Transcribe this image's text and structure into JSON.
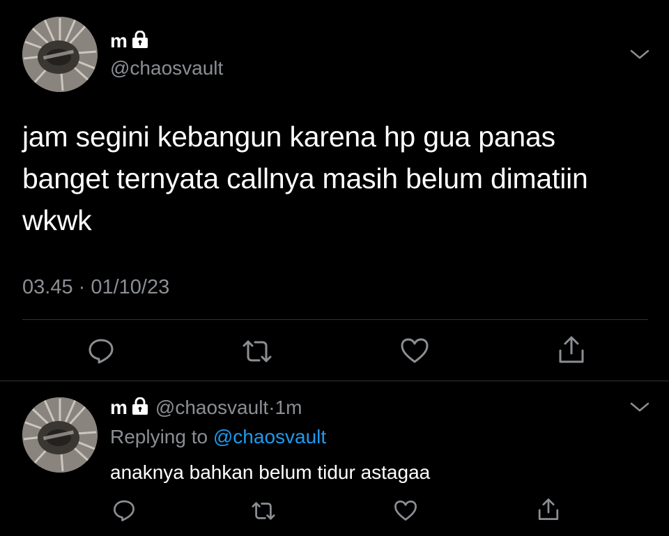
{
  "tweet": {
    "author_name": "m",
    "author_handle": "@chaosvault",
    "text_line1": "jam segini kebangun karena hp gua panas",
    "text_line2": "banget ternyata callnya masih belum dimatiin",
    "text_line3": "wkwk",
    "timestamp": "03.45 · 01/10/23",
    "icons": [
      "lock-icon",
      "chevron-down-icon",
      "reply-icon",
      "retweet-icon",
      "like-icon",
      "share-icon"
    ]
  },
  "reply": {
    "author_name": "m",
    "author_handle": "@chaosvault",
    "separator": "·",
    "time": "1m",
    "replying_prefix": "Replying to",
    "replying_mention": "@chaosvault",
    "text": "anaknya bahkan belum tidur astagaa"
  },
  "colors": {
    "background": "#000000",
    "primary_text": "#ffffff",
    "secondary_text": "#8b8f94",
    "link": "#1d9bf0",
    "divider": "#2f3336"
  }
}
